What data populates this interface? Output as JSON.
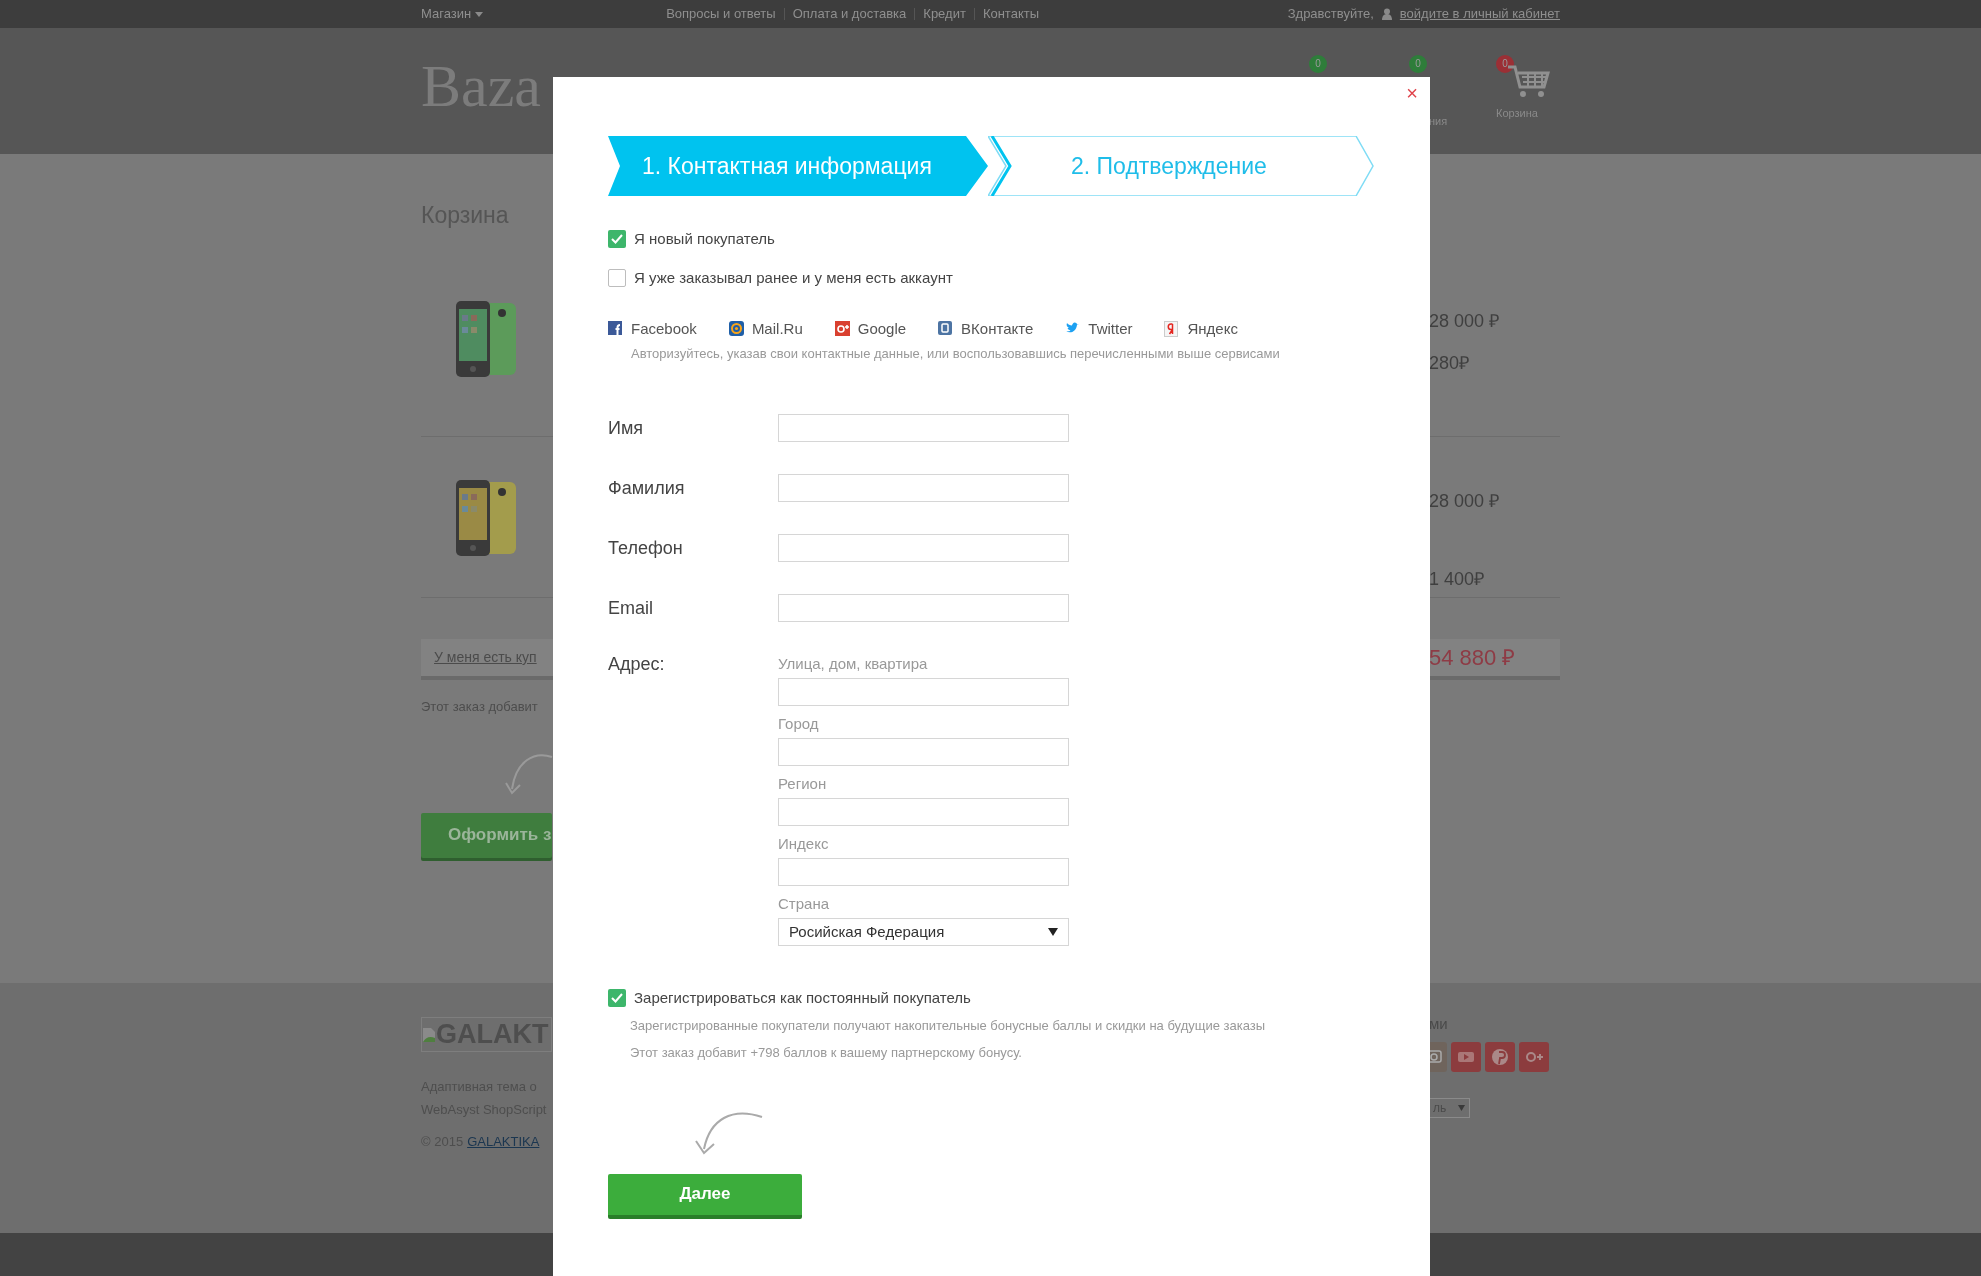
{
  "topbar": {
    "shop_menu": "Магазин",
    "links": [
      "Вопросы и ответы",
      "Оплата и доставка",
      "Кредит",
      "Контакты"
    ],
    "greeting": "Здравствуйте,",
    "login_link": "войдите в личный кабинет"
  },
  "header": {
    "logo": "Baza",
    "counters": [
      {
        "count": "0",
        "color": "#2e7d3a"
      },
      {
        "count": "0",
        "color": "#2e7d3a",
        "label": "ния"
      },
      {
        "count": "0",
        "color": "#9b2f35",
        "label": "Корзина"
      }
    ]
  },
  "cart": {
    "title": "Корзина",
    "items": [
      {
        "prices": [
          "28 000 ₽",
          "280₽"
        ]
      },
      {
        "prices": [
          "28 000 ₽",
          "1 400₽"
        ]
      }
    ],
    "coupon_link": "У меня есть куп",
    "total": "54 880 ₽",
    "bonus_note": "Этот заказ добавит",
    "checkout_button": "Оформить з"
  },
  "footer": {
    "logo_alt": "GALAKT",
    "description": [
      "Адаптивная тема о",
      "WebAsyst ShopScript"
    ],
    "copyright": "© 2015",
    "copyright_link": "GALAKTIKA",
    "social_heading": "ми",
    "social_buttons": [
      {
        "kind": "camera"
      },
      {
        "kind": "video"
      },
      {
        "kind": "pin"
      },
      {
        "kind": "gplus"
      }
    ],
    "select_value": "ль"
  },
  "modal": {
    "close": "×",
    "steps": [
      {
        "label": "1. Контактная информация",
        "selected": true
      },
      {
        "label": "2. Подтверждение",
        "selected": false
      }
    ],
    "customer_options": [
      {
        "label": "Я новый покупатель",
        "checked": true
      },
      {
        "label": "Я уже заказывал ранее и у меня есть аккаунт",
        "checked": false
      }
    ],
    "social_logins": [
      {
        "kind": "facebook",
        "label": "Facebook"
      },
      {
        "kind": "mailru",
        "label": "Mail.Ru"
      },
      {
        "kind": "google",
        "label": "Google"
      },
      {
        "kind": "vk",
        "label": "ВКонтакте"
      },
      {
        "kind": "twitter",
        "label": "Twitter"
      },
      {
        "kind": "yandex",
        "label": "Яндекс"
      }
    ],
    "auth_hint": "Авторизуйтесь, указав свои контактные данные, или воспользовавшись перечисленными выше сервисами",
    "fields": [
      {
        "label": "Имя"
      },
      {
        "label": "Фамилия"
      },
      {
        "label": "Телефон"
      },
      {
        "label": "Email"
      }
    ],
    "address": {
      "label": "Адрес:",
      "fields": [
        {
          "kind": "input",
          "label": "Улица, дом, квартира"
        },
        {
          "kind": "input",
          "label": "Город"
        },
        {
          "kind": "input",
          "label": "Регион"
        },
        {
          "kind": "input",
          "label": "Индекс"
        },
        {
          "kind": "select",
          "label": "Страна",
          "value": "Росийская Федерация"
        }
      ]
    },
    "register": {
      "label": "Зарегистрироваться как постоянный покупатель",
      "checked": true,
      "notes": [
        "Зарегистрированные покупатели получают накопительные бонусные баллы и скидки на будущие заказы",
        "Этот заказ добавит +798 баллов к вашему партнерскому бонусу."
      ]
    },
    "next_button": "Далее"
  }
}
